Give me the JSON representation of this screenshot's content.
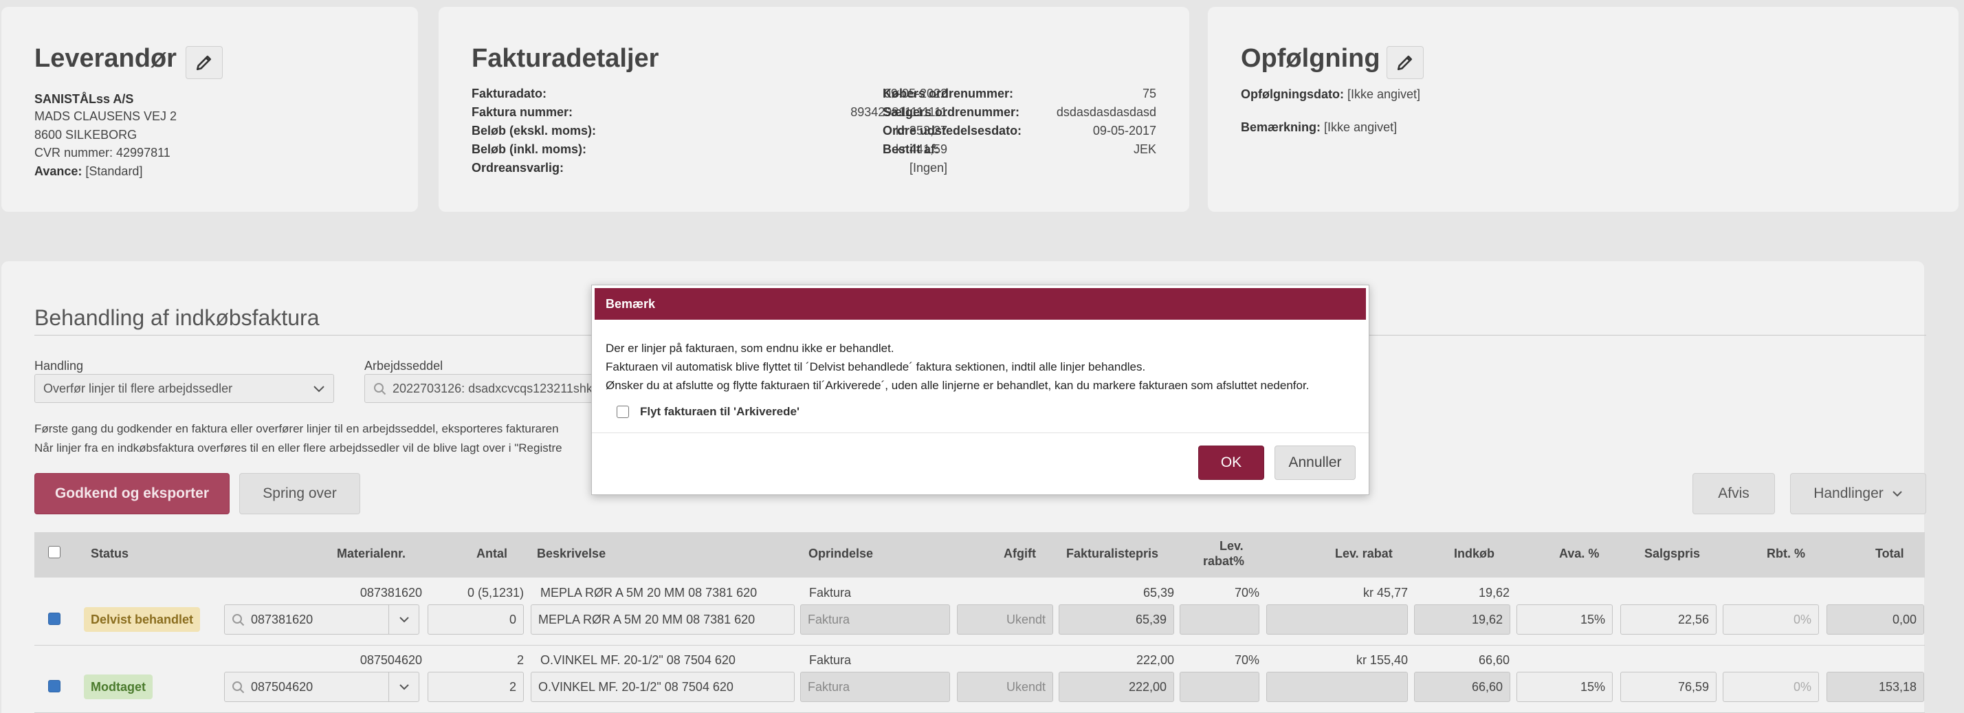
{
  "supplier": {
    "title": "Leverandør",
    "name": "SANISTÅLss A/S",
    "address1": "MADS CLAUSENS VEJ 2",
    "address2": "8600 SILKEBORG",
    "cvr": "CVR nummer: 42997811",
    "avance_label": "Avance:",
    "avance_value": "[Standard]"
  },
  "invoice": {
    "title": "Fakturadetaljer",
    "left": [
      {
        "label": "Fakturadato:",
        "value": "09-05-2022"
      },
      {
        "label": "Faktura nummer:",
        "value": "893429811111111"
      },
      {
        "label": "Beløb (ekskl. moms):",
        "value": "kr 353,27"
      },
      {
        "label": "Beløb (inkl. moms):",
        "value": "kr 441,59"
      },
      {
        "label": "Ordreansvarlig:",
        "value": "[Ingen]"
      }
    ],
    "right": [
      {
        "label": "Købers ordrenummer:",
        "value": "75"
      },
      {
        "label": "Sælgers ordrenummer:",
        "value": "dsdasdasdasdasd"
      },
      {
        "label": "Ordre udstedelsesdato:",
        "value": "09-05-2017"
      },
      {
        "label": "Bestilt af:",
        "value": "JEK"
      }
    ]
  },
  "followup": {
    "title": "Opfølgning",
    "date_label": "Opfølgningsdato:",
    "date_value": "[Ikke angivet]",
    "note_label": "Bemærkning:",
    "note_value": "[Ikke angivet]"
  },
  "processing": {
    "title": "Behandling af indkøbsfaktura",
    "action_label": "Handling",
    "action_value": "Overfør linjer til flere arbejdssedler",
    "worksheet_label": "Arbejdsseddel",
    "worksheet_value": "2022703126: dsadxcvcqs123211shk",
    "info1": "Første gang du godkender en faktura eller overfører linjer til en arbejdsseddel, eksporteres fakturaren",
    "info2": "Når linjer fra en indkøbsfaktura overføres til en eller flere arbejdssedler vil de blive lagt over i \"Registre",
    "approve_label": "Godkend og eksporter",
    "skip_label": "Spring over",
    "reject_label": "Afvis",
    "actions_label": "Handlinger"
  },
  "table": {
    "headers": {
      "status": "Status",
      "material": "Materialenr.",
      "qty": "Antal",
      "desc": "Beskrivelse",
      "origin": "Oprindelse",
      "fee": "Afgift",
      "listprice": "Fakturalistepris",
      "levrabat_pct_1": "Lev.",
      "levrabat_pct_2": "rabat%",
      "levrabat": "Lev. rabat",
      "purchase": "Indkøb",
      "ava": "Ava. %",
      "sale": "Salgspris",
      "rbt": "Rbt. %",
      "total": "Total"
    },
    "rows": [
      {
        "checked": true,
        "orig_material": "087381620",
        "orig_qty": "0 (5,1231)",
        "orig_desc": "MEPLA RØR A 5M 20 MM 08 7381 620",
        "orig_origin": "Faktura",
        "orig_listprice": "65,39",
        "orig_levrabat_pct": "70%",
        "orig_levrabat": "kr 45,77",
        "orig_purchase": "19,62",
        "status": "Delvist behandlet",
        "status_bg": "#f2e3b5",
        "status_fg": "#8a6d1e",
        "material": "087381620",
        "qty": "0",
        "desc": "MEPLA RØR A 5M  20 MM  08 7381 620",
        "origin": "Faktura",
        "fee": "Ukendt",
        "listprice": "65,39",
        "levrabat_pct": "",
        "levrabat": "",
        "purchase": "19,62",
        "ava": "15%",
        "sale": "22,56",
        "rbt": "0%",
        "total": "0,00"
      },
      {
        "checked": true,
        "orig_material": "087504620",
        "orig_qty": "2",
        "orig_desc": "O.VINKEL MF. 20-1/2\" 08 7504 620",
        "orig_origin": "Faktura",
        "orig_listprice": "222,00",
        "orig_levrabat_pct": "70%",
        "orig_levrabat": "kr 155,40",
        "orig_purchase": "66,60",
        "status": "Modtaget",
        "status_bg": "#d3e7c4",
        "status_fg": "#4a7a2c",
        "material": "087504620",
        "qty": "2",
        "desc": "O.VINKEL MF.   20-1/2\" 08 7504 620",
        "origin": "Faktura",
        "fee": "Ukendt",
        "listprice": "222,00",
        "levrabat_pct": "",
        "levrabat": "",
        "purchase": "66,60",
        "ava": "15%",
        "sale": "76,59",
        "rbt": "0%",
        "total": "153,18"
      }
    ]
  },
  "modal": {
    "title": "Bemærk",
    "line1": "Der er linjer på fakturaen, som endnu ikke er behandlet.",
    "line2": "Fakturaen vil automatisk blive flyttet til ´Delvist behandlede´ faktura sektionen, indtil alle linjer behandles.",
    "line3": "Ønsker du at afslutte og flytte fakturaen til´Arkiverede´, uden alle linjerne er behandlet, kan du markere fakturaen som afsluttet nedenfor.",
    "checkbox_label": "Flyt fakturaen til 'Arkiverede'",
    "ok_label": "OK",
    "cancel_label": "Annuller"
  },
  "colors": {
    "brand": "#8a1f3e",
    "primary_button": "#a8465f"
  }
}
